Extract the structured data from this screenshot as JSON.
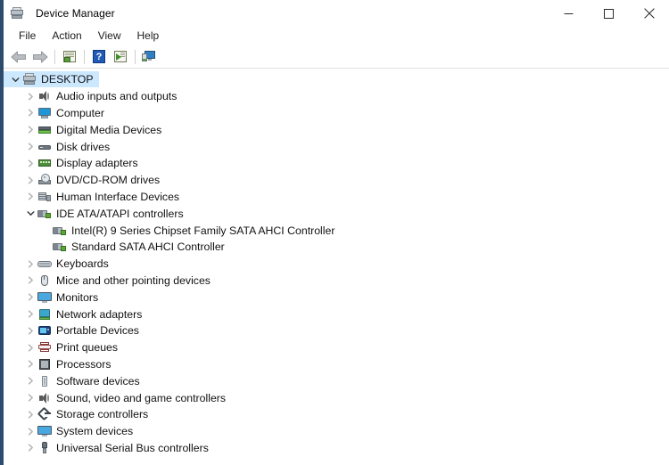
{
  "window": {
    "title": "Device Manager",
    "title_icon": "device-manager-icon",
    "controls": {
      "minimize": "minimize-icon",
      "maximize": "maximize-icon",
      "close": "close-icon"
    }
  },
  "menubar": {
    "items": [
      {
        "label": "File"
      },
      {
        "label": "Action"
      },
      {
        "label": "View"
      },
      {
        "label": "Help"
      }
    ]
  },
  "toolbar": {
    "buttons": [
      {
        "name": "back-arrow-icon",
        "kind": "back"
      },
      {
        "name": "forward-arrow-icon",
        "kind": "forward"
      },
      {
        "name": "separator-1",
        "kind": "sep"
      },
      {
        "name": "properties-icon",
        "kind": "props"
      },
      {
        "name": "separator-2",
        "kind": "sep"
      },
      {
        "name": "help-icon",
        "kind": "help",
        "glyph": "?"
      },
      {
        "name": "update-driver-icon",
        "kind": "update"
      },
      {
        "name": "separator-3",
        "kind": "sep"
      },
      {
        "name": "scan-for-hardware-changes-icon",
        "kind": "scan"
      }
    ]
  },
  "tree": {
    "nodes": [
      {
        "label": "DESKTOP",
        "level": 0,
        "state": "expanded",
        "icon": "root",
        "selected": true
      },
      {
        "label": "Audio inputs and outputs",
        "level": 1,
        "state": "collapsed",
        "icon": "speaker",
        "selected": false
      },
      {
        "label": "Computer",
        "level": 1,
        "state": "collapsed",
        "icon": "computer",
        "selected": false
      },
      {
        "label": "Digital Media Devices",
        "level": 1,
        "state": "collapsed",
        "icon": "media",
        "selected": false
      },
      {
        "label": "Disk drives",
        "level": 1,
        "state": "collapsed",
        "icon": "disk",
        "selected": false
      },
      {
        "label": "Display adapters",
        "level": 1,
        "state": "collapsed",
        "icon": "gpu",
        "selected": false
      },
      {
        "label": "DVD/CD-ROM drives",
        "level": 1,
        "state": "collapsed",
        "icon": "dvd",
        "selected": false
      },
      {
        "label": "Human Interface Devices",
        "level": 1,
        "state": "collapsed",
        "icon": "hid",
        "selected": false
      },
      {
        "label": "IDE ATA/ATAPI controllers",
        "level": 1,
        "state": "expanded",
        "icon": "ide",
        "selected": false
      },
      {
        "label": "Intel(R) 9 Series Chipset Family SATA AHCI Controller",
        "level": 2,
        "state": "leaf",
        "icon": "ide",
        "selected": false
      },
      {
        "label": "Standard SATA AHCI Controller",
        "level": 2,
        "state": "leaf",
        "icon": "ide",
        "selected": false
      },
      {
        "label": "Keyboards",
        "level": 1,
        "state": "collapsed",
        "icon": "keyboard",
        "selected": false
      },
      {
        "label": "Mice and other pointing devices",
        "level": 1,
        "state": "collapsed",
        "icon": "mouse",
        "selected": false
      },
      {
        "label": "Monitors",
        "level": 1,
        "state": "collapsed",
        "icon": "monitor",
        "selected": false
      },
      {
        "label": "Network adapters",
        "level": 1,
        "state": "collapsed",
        "icon": "net",
        "selected": false
      },
      {
        "label": "Portable Devices",
        "level": 1,
        "state": "collapsed",
        "icon": "portable",
        "selected": false
      },
      {
        "label": "Print queues",
        "level": 1,
        "state": "collapsed",
        "icon": "printer",
        "selected": false
      },
      {
        "label": "Processors",
        "level": 1,
        "state": "collapsed",
        "icon": "cpu",
        "selected": false
      },
      {
        "label": "Software devices",
        "level": 1,
        "state": "collapsed",
        "icon": "sw",
        "selected": false
      },
      {
        "label": "Sound, video and game controllers",
        "level": 1,
        "state": "collapsed",
        "icon": "speaker",
        "selected": false
      },
      {
        "label": "Storage controllers",
        "level": 1,
        "state": "collapsed",
        "icon": "storage",
        "selected": false
      },
      {
        "label": "System devices",
        "level": 1,
        "state": "collapsed",
        "icon": "monitor",
        "selected": false
      },
      {
        "label": "Universal Serial Bus controllers",
        "level": 1,
        "state": "collapsed",
        "icon": "usb",
        "selected": false
      }
    ]
  },
  "colors": {
    "selection": "#cce8ff",
    "window_background": "#ffffff",
    "toolbar_border": "#e0e0e0",
    "text": "#111111"
  }
}
